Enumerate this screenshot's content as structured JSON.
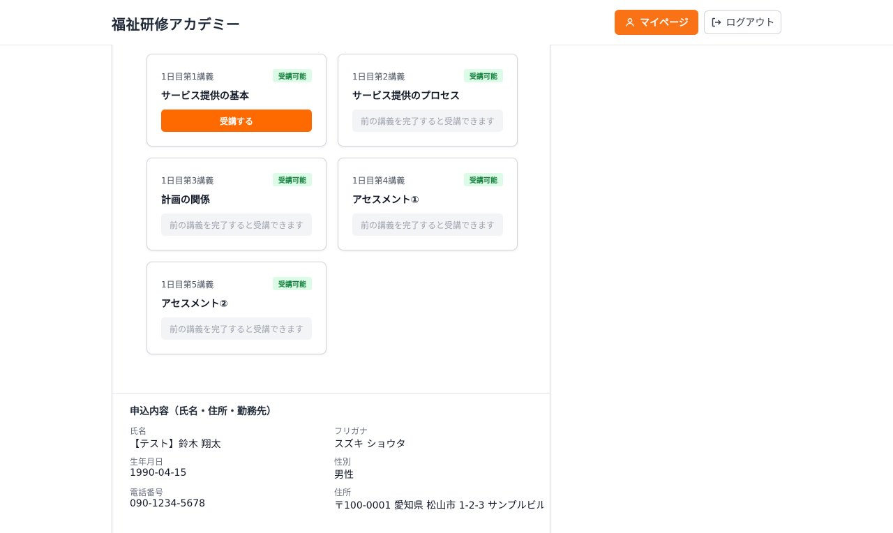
{
  "header": {
    "brand": "福祉研修アカデミー",
    "mypage_label": "マイページ",
    "logout_label": "ログアウト"
  },
  "lectures": [
    {
      "day": "1日目第1講義",
      "badge": "受講可能",
      "title": "サービス提供の基本",
      "action": "受講する"
    },
    {
      "day": "1日目第2講義",
      "badge": "受講可能",
      "title": "サービス提供のプロセス",
      "action": "前の講義を完了すると受講できます"
    },
    {
      "day": "1日目第3講義",
      "badge": "受講可能",
      "title": "計画の関係",
      "action": "前の講義を完了すると受講できます"
    },
    {
      "day": "1日目第4講義",
      "badge": "受講可能",
      "title": "アセスメント①",
      "action": "前の講義を完了すると受講できます"
    },
    {
      "day": "1日目第5講義",
      "badge": "受講可能",
      "title": "アセスメント②",
      "action": "前の講義を完了すると受講できます"
    }
  ],
  "application": {
    "title": "申込内容（氏名・住所・勤務先）",
    "fields": [
      {
        "label": "氏名",
        "value": "【テスト】鈴木 翔太"
      },
      {
        "label": "フリガナ",
        "value": "スズキ ショウタ"
      },
      {
        "label": "生年月日",
        "value": "1990-04-15"
      },
      {
        "label": "性別",
        "value": "男性"
      },
      {
        "label": "電話番号",
        "value": "090-1234-5678"
      },
      {
        "label": "住所",
        "value": "〒100-0001 愛知県 松山市 1-2-3 サンプルビル"
      }
    ]
  },
  "colors": {
    "accent": "#f97316",
    "primary_button": "#ff6a00",
    "badge_bg": "#dcfce7",
    "badge_text": "#15803d"
  }
}
